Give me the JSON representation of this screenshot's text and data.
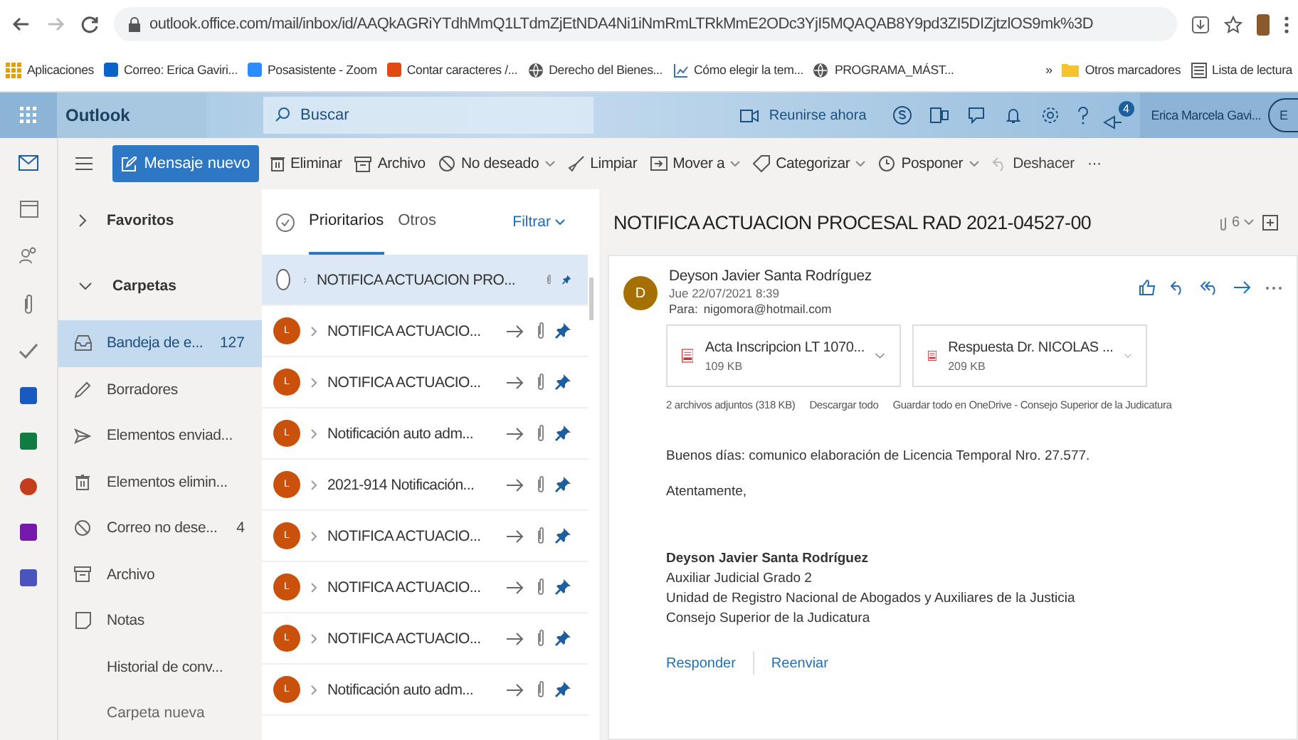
{
  "browser": {
    "url": "outlook.office.com/mail/inbox/id/AAQkAGRiYTdhMmQ1LTdmZjEtNDA4Ni1iNmRmLTRkMmE2ODc3YjI5MQAQAB8Y9pd3ZI5DIZjtzlOS9mk%3D",
    "bookmarks": [
      {
        "label": "Aplicaciones",
        "kind": "apps"
      },
      {
        "label": "Correo: Erica Gaviri...",
        "kind": "outlook"
      },
      {
        "label": "Posasistente - Zoom",
        "kind": "zoom"
      },
      {
        "label": "Contar caracteres /...",
        "kind": "counter"
      },
      {
        "label": "Derecho del Bienes...",
        "kind": "globe"
      },
      {
        "label": "Cómo elegir la tem...",
        "kind": "chart"
      },
      {
        "label": "PROGRAMA_MÁST...",
        "kind": "globe"
      }
    ],
    "more": "»",
    "other_bookmarks": "Otros marcadores",
    "reading_list": "Lista de lectura"
  },
  "header": {
    "app_name": "Outlook",
    "search": {
      "placeholder": "Buscar"
    },
    "meet_now": "Reunirse ahora",
    "notification_count": "4",
    "user": "Erica Marcela Gavi...",
    "user_initial": "E"
  },
  "toolbar": {
    "new_message": "Mensaje nuevo",
    "actions": [
      {
        "label": "Eliminar",
        "kind": "trash",
        "dropdown": false,
        "disabled": false
      },
      {
        "label": "Archivo",
        "kind": "archive",
        "dropdown": false,
        "disabled": false
      },
      {
        "label": "No deseado",
        "kind": "block",
        "dropdown": true,
        "disabled": false
      },
      {
        "label": "Limpiar",
        "kind": "broom",
        "dropdown": false,
        "disabled": false
      },
      {
        "label": "Mover a",
        "kind": "move",
        "dropdown": true,
        "disabled": false
      },
      {
        "label": "Categorizar",
        "kind": "tag",
        "dropdown": true,
        "disabled": false
      },
      {
        "label": "Posponer",
        "kind": "clock",
        "dropdown": true,
        "disabled": false
      },
      {
        "label": "Deshacer",
        "kind": "undo",
        "dropdown": false,
        "disabled": true
      }
    ],
    "more": "···"
  },
  "folders": {
    "favorites": "Favoritos",
    "heading": "Carpetas",
    "items": [
      {
        "label": "Bandeja de e...",
        "count": "127",
        "kind": "inbox",
        "selected": true
      },
      {
        "label": "Borradores",
        "kind": "pencil",
        "selected": false
      },
      {
        "label": "Elementos enviad...",
        "kind": "send",
        "selected": false
      },
      {
        "label": "Elementos elimin...",
        "kind": "trash",
        "selected": false
      },
      {
        "label": "Correo no dese...",
        "count": "4",
        "kind": "block",
        "selected": false
      },
      {
        "label": "Archivo",
        "kind": "archive",
        "selected": false
      },
      {
        "label": "Notas",
        "kind": "note",
        "selected": false
      },
      {
        "label": "Historial de conv...",
        "kind": "none",
        "selected": false
      }
    ],
    "new_folder": "Carpeta nueva"
  },
  "message_list": {
    "tabs": [
      {
        "label": "Prioritarios",
        "selected": true
      },
      {
        "label": "Otros",
        "selected": false
      }
    ],
    "filter": "Filtrar",
    "messages": [
      {
        "subject": "NOTIFICA ACTUACION PRO...",
        "selected": true
      },
      {
        "initial": "L",
        "subject": "NOTIFICA ACTUACIO...",
        "selected": false
      },
      {
        "initial": "L",
        "subject": "NOTIFICA ACTUACIO...",
        "selected": false
      },
      {
        "initial": "L",
        "subject": "Notificación auto adm...",
        "selected": false
      },
      {
        "initial": "L",
        "subject": "2021-914 Notificación...",
        "selected": false
      },
      {
        "initial": "L",
        "subject": "NOTIFICA ACTUACIO...",
        "selected": false
      },
      {
        "initial": "L",
        "subject": "NOTIFICA ACTUACIO...",
        "selected": false
      },
      {
        "initial": "L",
        "subject": "NOTIFICA ACTUACIO...",
        "selected": false
      },
      {
        "initial": "L",
        "subject": "Notificación auto adm...",
        "selected": false
      }
    ]
  },
  "reading": {
    "subject": "NOTIFICA ACTUACION PROCESAL RAD 2021-04527-00",
    "message_count": "6",
    "sender_initial": "D",
    "sender": "Deyson Javier Santa Rodríguez",
    "date": "Jue 22/07/2021 8:39",
    "to_label": "Para:",
    "to": "nigomora@hotmail.com",
    "attachments": [
      {
        "name": "Acta Inscripcion LT 1070...",
        "size": "109 KB"
      },
      {
        "name": "Respuesta Dr. NICOLAS ...",
        "size": "209 KB"
      }
    ],
    "attachments_summary": "2 archivos adjuntos (318 KB)",
    "download_all": "Descargar todo",
    "save_all": "Guardar todo en OneDrive - Consejo Superior de la Judicatura",
    "body": [
      "Buenos días: comunico elaboración de Licencia Temporal Nro. 27.577.",
      "Atentamente,"
    ],
    "signature": [
      "Deyson Javier Santa Rodríguez",
      "Auxiliar Judicial Grado 2",
      "Unidad de Registro Nacional de Abogados y Auxiliares de la Justicia",
      "Consejo Superior de la Judicatura"
    ],
    "reply": "Responder",
    "forward": "Reenviar"
  }
}
